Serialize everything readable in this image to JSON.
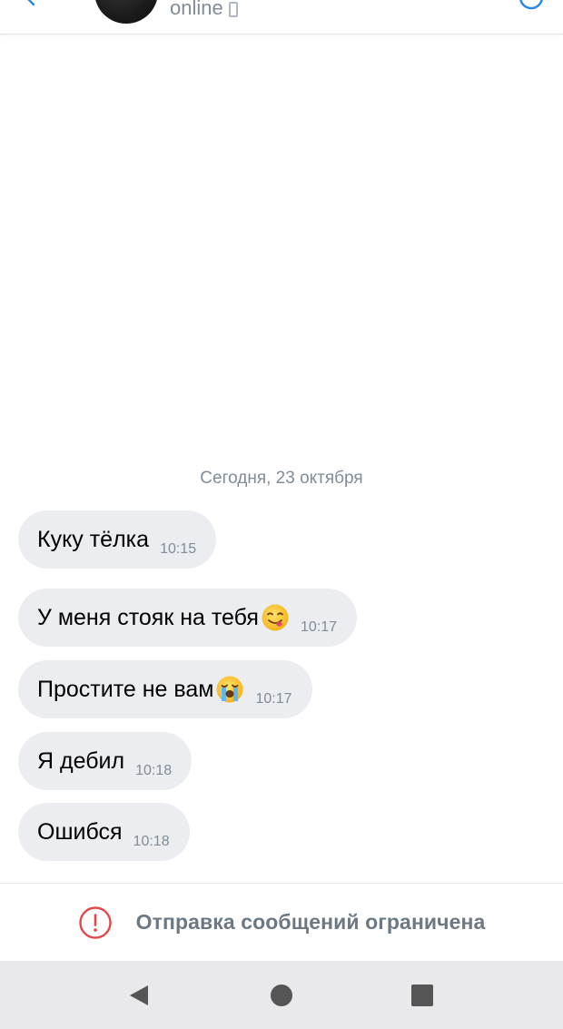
{
  "header": {
    "status": "online",
    "icons": [
      "back-arrow-icon",
      "avatar",
      "mobile-device-icon",
      "call-icon"
    ]
  },
  "chat": {
    "date_separator": "Сегодня, 23 октября",
    "messages": [
      {
        "text": "Куку тёлка",
        "time": "10:15",
        "emoji": ""
      },
      {
        "text": "У меня стояк на тебя",
        "time": "10:17",
        "emoji": "face-savoring-food-emoji"
      },
      {
        "text": "Простите не вам",
        "time": "10:17",
        "emoji": "loudly-crying-face-emoji"
      },
      {
        "text": "Я дебил",
        "time": "10:18",
        "emoji": ""
      },
      {
        "text": "Ошибся",
        "time": "10:18",
        "emoji": ""
      }
    ]
  },
  "restriction": {
    "text": "Отправка сообщений ограничена",
    "icon": "warning-circle-icon"
  },
  "navbar": {
    "icons": [
      "nav-back-icon",
      "nav-home-icon",
      "nav-recents-icon"
    ],
    "background": "#e9e9ec"
  },
  "colors": {
    "bubble": "#ebedf0",
    "secondary_text": "#818c99",
    "warning": "#e64646",
    "accent": "#2688eb"
  }
}
